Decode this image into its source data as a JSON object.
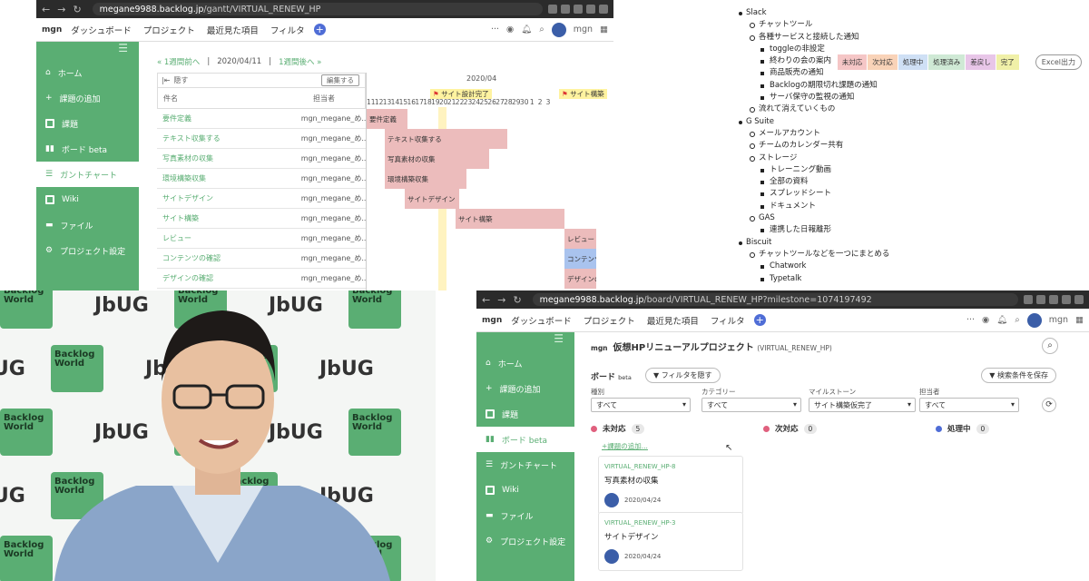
{
  "top_left": {
    "url_host": "megane9988.backlog.jp",
    "url_path": "/gantt/VIRTUAL_RENEW_HP",
    "logo": "mgn",
    "menu": [
      "ダッシュボード",
      "プロジェクト",
      "最近見た項目",
      "フィルタ"
    ],
    "user": "mgn",
    "sidebar": [
      "ホーム",
      "課題の追加",
      "課題",
      "ボード beta",
      "ガントチャート",
      "Wiki",
      "ファイル",
      "プロジェクト設定"
    ],
    "nav_prev": "« 1週間前へ",
    "date": "2020/04/11",
    "nav_next": "1週間後へ »",
    "legend": [
      {
        "label": "未対応",
        "color": "#f5c6c6"
      },
      {
        "label": "次対応",
        "color": "#f9d3b8"
      },
      {
        "label": "処理中",
        "color": "#cfe0f5"
      },
      {
        "label": "処理済み",
        "color": "#cfe9d5"
      },
      {
        "label": "差戻し",
        "color": "#e8c6e8"
      },
      {
        "label": "完了",
        "color": "#f0f0a8"
      }
    ],
    "excel": "Excel出力",
    "hide": "隠す",
    "edit": "編集する",
    "col_task": "件名",
    "col_owner": "担当者",
    "month": "2020/04",
    "milestone1": "サイト設計完了",
    "milestone2": "サイト構築",
    "days": [
      "11",
      "12",
      "13",
      "14",
      "15",
      "16",
      "17",
      "18",
      "19",
      "20",
      "21",
      "22",
      "23",
      "24",
      "25",
      "26",
      "27",
      "28",
      "29",
      "30",
      "1",
      "2",
      "3"
    ],
    "rows": [
      {
        "task": "要件定義",
        "owner": "mgn_megane_め...",
        "bar": "要件定義"
      },
      {
        "task": "テキスト収集する",
        "owner": "mgn_megane_め...",
        "bar": "テキスト収集する"
      },
      {
        "task": "写真素材の収集",
        "owner": "mgn_megane_め...",
        "bar": "写真素材の収集"
      },
      {
        "task": "環境構築収集",
        "owner": "mgn_megane_め...",
        "bar": "環境構築収集"
      },
      {
        "task": "サイトデザイン",
        "owner": "mgn_megane_め...",
        "bar": "サイトデザイン"
      },
      {
        "task": "サイト構築",
        "owner": "mgn_megane_め...",
        "bar": "サイト構築"
      },
      {
        "task": "レビュー",
        "owner": "mgn_megane_め...",
        "bar": "レビュー"
      },
      {
        "task": "コンテンツの確認",
        "owner": "mgn_megane_め...",
        "bar": "コンテンツ"
      },
      {
        "task": "デザインの確認",
        "owner": "mgn_megane_め...",
        "bar": "デザインの"
      }
    ]
  },
  "outline": [
    {
      "level": 1,
      "text": "Slack"
    },
    {
      "level": 2,
      "text": "チャットツール"
    },
    {
      "level": 2,
      "text": "各種サービスと接続した通知"
    },
    {
      "level": 3,
      "text": "toggleの非設定"
    },
    {
      "level": 3,
      "text": "終わりの会の案内"
    },
    {
      "level": 3,
      "text": "商品販売の通知"
    },
    {
      "level": 3,
      "text": "Backlogの期限切れ課題の通知"
    },
    {
      "level": 3,
      "text": "サーバ保守の監視の通知"
    },
    {
      "level": 2,
      "text": "流れて消えていくもの"
    },
    {
      "level": 1,
      "text": "G Suite"
    },
    {
      "level": 2,
      "text": "メールアカウント"
    },
    {
      "level": 2,
      "text": "チームのカレンダー共有"
    },
    {
      "level": 2,
      "text": "ストレージ"
    },
    {
      "level": 3,
      "text": "トレーニング動画"
    },
    {
      "level": 3,
      "text": "全部の資料"
    },
    {
      "level": 3,
      "text": "スプレッドシート"
    },
    {
      "level": 3,
      "text": "ドキュメント"
    },
    {
      "level": 2,
      "text": "GAS"
    },
    {
      "level": 3,
      "text": "連携した日報離形"
    },
    {
      "level": 1,
      "text": "Biscuit"
    },
    {
      "level": 2,
      "text": "チャットツールなどを一つにまとめる"
    },
    {
      "level": 3,
      "text": "Chatwork"
    },
    {
      "level": 3,
      "text": "Typetalk"
    }
  ],
  "webcam": {
    "logo_line1": "Backlog",
    "logo_line2": "World",
    "jbug": "JbUG"
  },
  "board": {
    "url_host": "megane9988.backlog.jp",
    "url_path": "/board/VIRTUAL_RENEW_HP?milestone=1074197492",
    "project_title": "仮想HPリニューアルプロジェクト",
    "project_key": "(VIRTUAL_RENEW_HP)",
    "board_label": "ボード",
    "beta": "beta",
    "hide_filter": "フィルタを隠す",
    "save_search": "検索条件を保存",
    "filters": [
      {
        "label": "種別",
        "value": "すべて"
      },
      {
        "label": "カテゴリー",
        "value": "すべて"
      },
      {
        "label": "マイルストーン",
        "value": "サイト構築仮完了"
      },
      {
        "label": "担当者",
        "value": "すべて"
      }
    ],
    "columns": [
      {
        "label": "未対応",
        "count": "5",
        "color": "#e0607e"
      },
      {
        "label": "次対応",
        "count": "0",
        "color": "#e0607e"
      },
      {
        "label": "処理中",
        "count": "0",
        "color": "#4f6dd6"
      }
    ],
    "add_issue": "+課題の追加...",
    "cards": [
      {
        "key": "VIRTUAL_RENEW_HP-8",
        "summary": "写真素材の収集",
        "date": "2020/04/24"
      },
      {
        "key": "VIRTUAL_RENEW_HP-3",
        "summary": "サイトデザイン",
        "date": "2020/04/24"
      }
    ]
  }
}
